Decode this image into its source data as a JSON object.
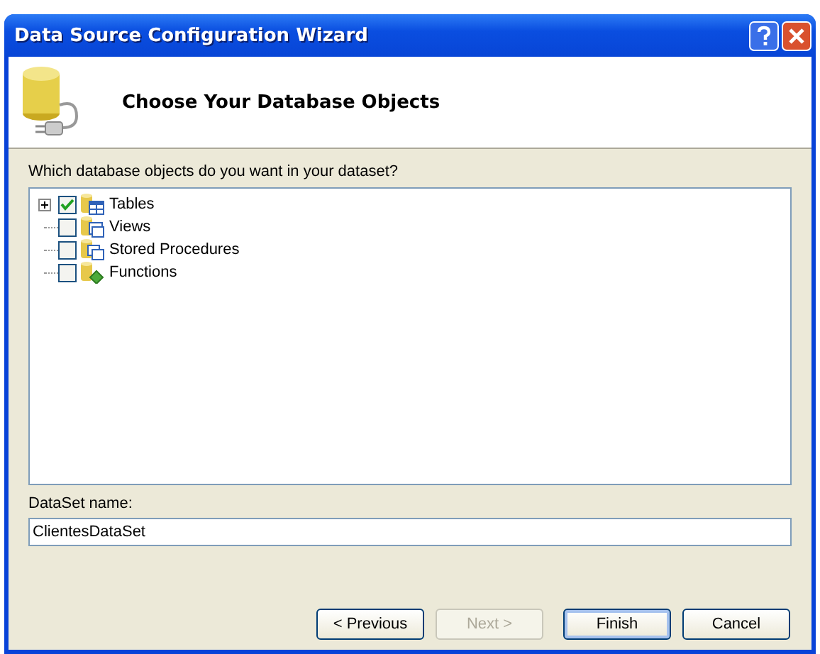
{
  "window": {
    "title": "Data Source Configuration Wizard"
  },
  "header": {
    "title": "Choose Your Database Objects"
  },
  "prompt": "Which database objects do you want in your dataset?",
  "tree": [
    {
      "label": "Tables",
      "kind": "table",
      "checked": true,
      "expandable": true
    },
    {
      "label": "Views",
      "kind": "view",
      "checked": false,
      "expandable": false
    },
    {
      "label": "Stored Procedures",
      "kind": "procedure",
      "checked": false,
      "expandable": false
    },
    {
      "label": "Functions",
      "kind": "function",
      "checked": false,
      "expandable": false
    }
  ],
  "dataset_name": {
    "label": "DataSet name:",
    "value": "ClientesDataSet"
  },
  "buttons": [
    {
      "label": "< Previous",
      "disabled": false,
      "default": false
    },
    {
      "label": "Next >",
      "disabled": true,
      "default": false
    },
    {
      "label": "Finish",
      "disabled": false,
      "default": true
    },
    {
      "label": "Cancel",
      "disabled": false,
      "default": false
    }
  ]
}
